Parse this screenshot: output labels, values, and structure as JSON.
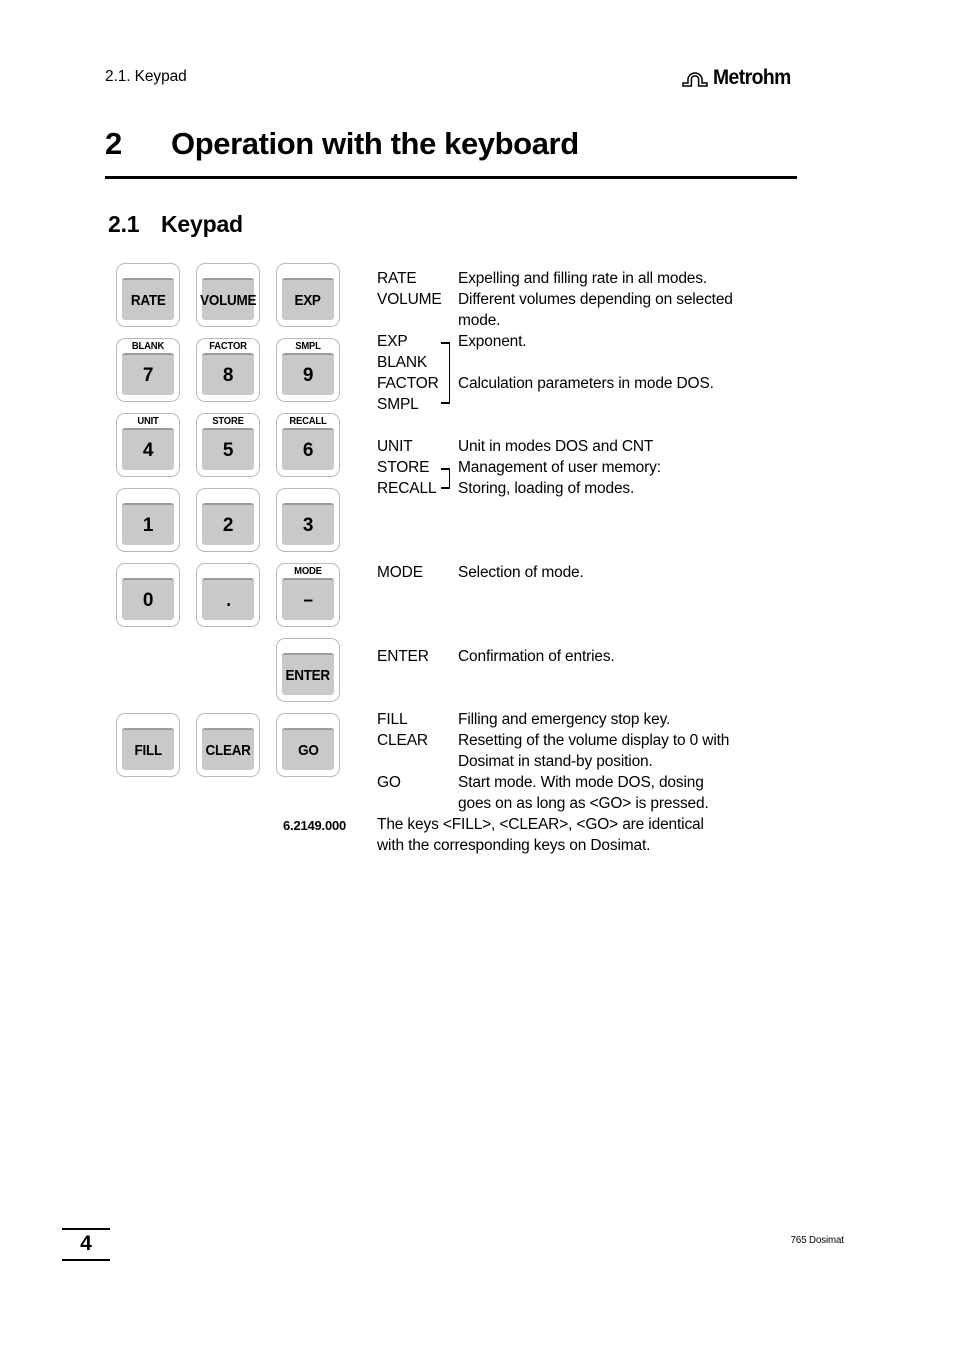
{
  "header": {
    "running_title": "2.1. Keypad",
    "logo_word": "Metrohm",
    "logo_mark": "omega-arch-icon"
  },
  "chapter": {
    "number": "2",
    "title": "Operation with the keyboard"
  },
  "section": {
    "number": "2.1",
    "title": "Keypad"
  },
  "keypad": {
    "part_number": "6.2149.000",
    "rows": [
      [
        {
          "top": "",
          "main": "RATE",
          "kind": "word"
        },
        {
          "top": "",
          "main": "VOLUME",
          "kind": "word"
        },
        {
          "top": "",
          "main": "EXP",
          "kind": "word"
        }
      ],
      [
        {
          "top": "BLANK",
          "main": "7",
          "kind": "num"
        },
        {
          "top": "FACTOR",
          "main": "8",
          "kind": "num"
        },
        {
          "top": "SMPL",
          "main": "9",
          "kind": "num"
        }
      ],
      [
        {
          "top": "UNIT",
          "main": "4",
          "kind": "num"
        },
        {
          "top": "STORE",
          "main": "5",
          "kind": "num"
        },
        {
          "top": "RECALL",
          "main": "6",
          "kind": "num"
        }
      ],
      [
        {
          "top": "",
          "main": "1",
          "kind": "num"
        },
        {
          "top": "",
          "main": "2",
          "kind": "num"
        },
        {
          "top": "",
          "main": "3",
          "kind": "num"
        }
      ],
      [
        {
          "top": "",
          "main": "0",
          "kind": "num"
        },
        {
          "top": "",
          "main": ".",
          "kind": "dot"
        },
        {
          "top": "MODE",
          "main": "–",
          "kind": "dash"
        }
      ],
      [
        {
          "top": "",
          "main": "",
          "kind": "empty"
        },
        {
          "top": "",
          "main": "",
          "kind": "empty"
        },
        {
          "top": "",
          "main": "ENTER",
          "kind": "word"
        }
      ],
      [
        {
          "top": "",
          "main": "FILL",
          "kind": "word"
        },
        {
          "top": "",
          "main": "CLEAR",
          "kind": "word"
        },
        {
          "top": "",
          "main": "GO",
          "kind": "word"
        }
      ]
    ]
  },
  "descriptions": {
    "rate_key": "RATE",
    "rate_text": "Expelling and filling rate in all modes.",
    "volume_key": "VOLUME",
    "volume_text": "Different volumes depending on selected",
    "volume_text2": "mode.",
    "exp_key": "EXP",
    "exp_text": "Exponent.",
    "blank_key": "BLANK",
    "factor_key": "FACTOR",
    "factor_text": "Calculation parameters in mode DOS.",
    "smpl_key": "SMPL",
    "unit_key": "UNIT",
    "unit_text": "Unit in modes DOS and CNT",
    "store_key": "STORE",
    "store_text": "Management of user memory:",
    "recall_key": "RECALL",
    "recall_text": "Storing, loading of modes.",
    "mode_key": "MODE",
    "mode_text": "Selection of mode.",
    "enter_key": "ENTER",
    "enter_text": "Confirmation of entries.",
    "fill_key": "FILL",
    "fill_text": "Filling and emergency stop key.",
    "clear_key": "CLEAR",
    "clear_text": "Resetting of the volume display to 0 with",
    "clear_text2": "Dosimat in stand-by position.",
    "go_key": "GO",
    "go_text": "Start mode. With mode DOS, dosing",
    "go_text2": "goes on as long as <GO> is pressed.",
    "note_line1": "The keys <FILL>, <CLEAR>, <GO> are identical",
    "note_line2": "with the corresponding keys on Dosimat."
  },
  "footer": {
    "page_number": "4",
    "document": "765 Dosimat"
  }
}
